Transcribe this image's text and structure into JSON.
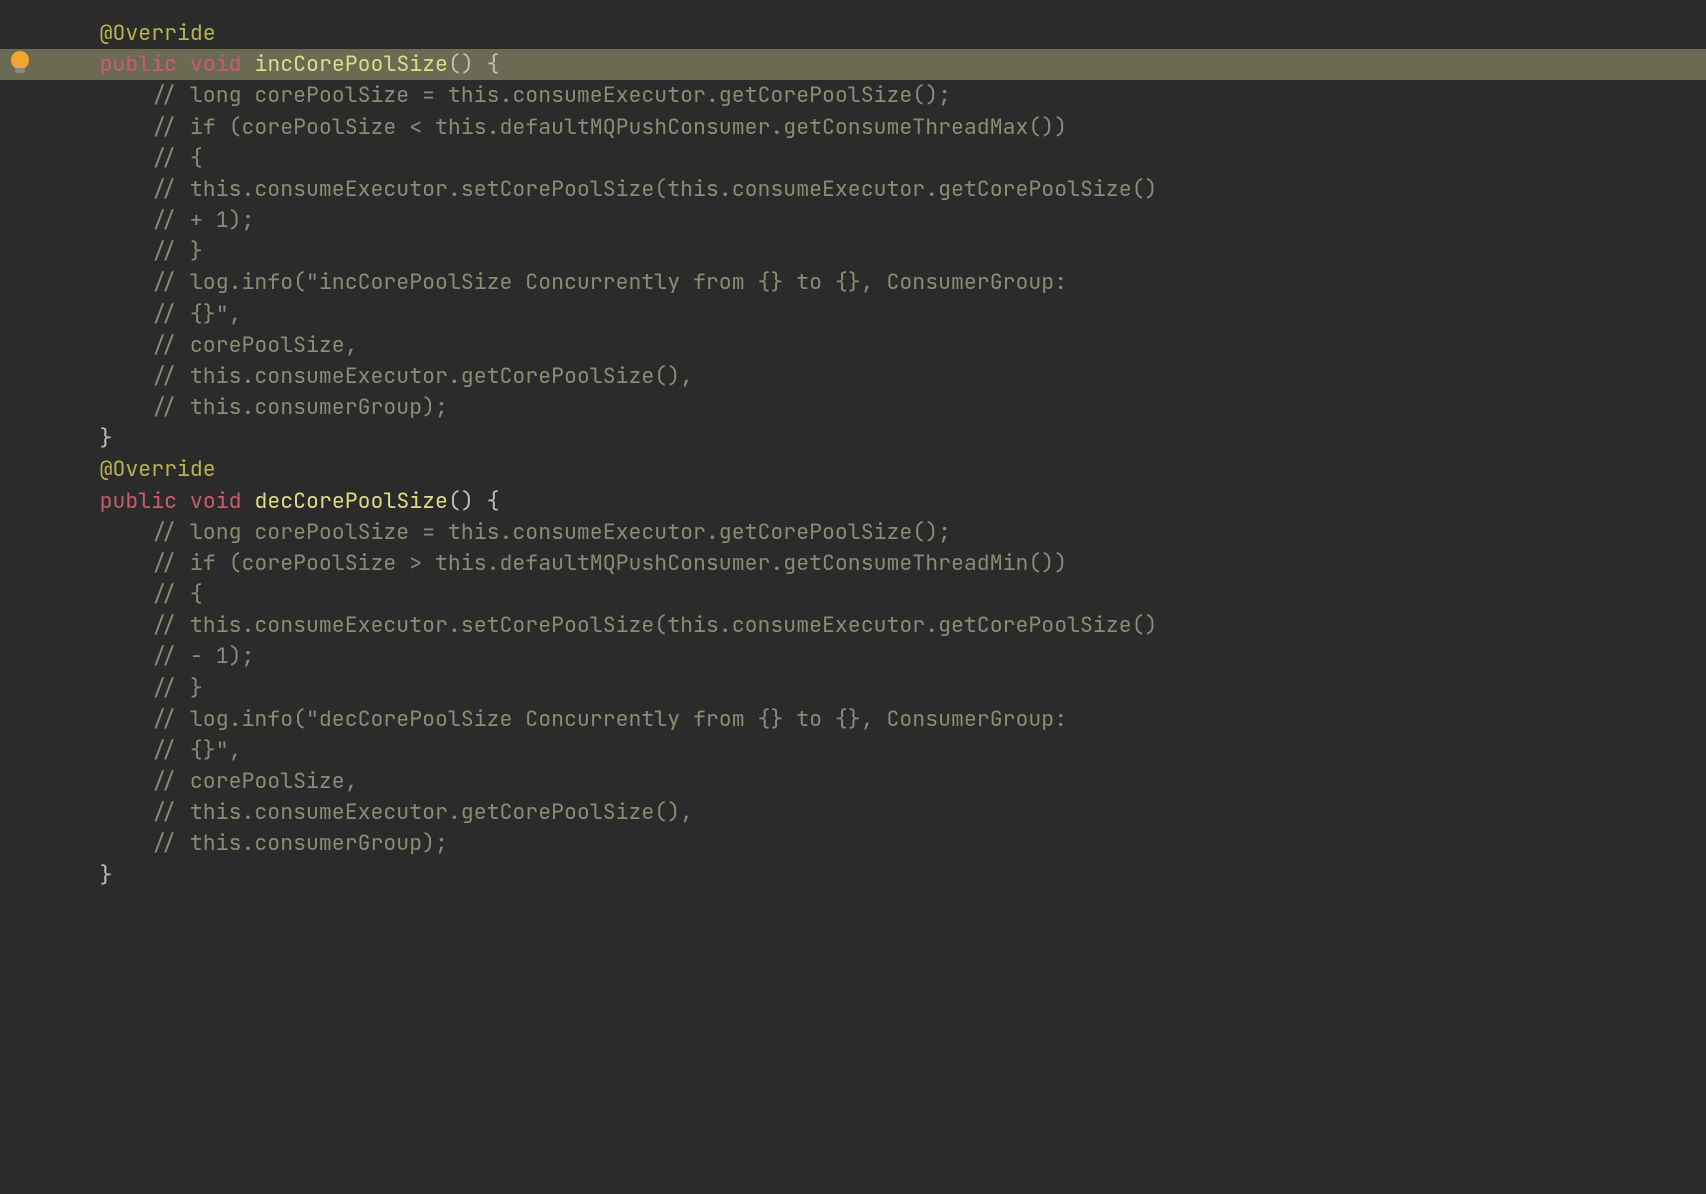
{
  "code": {
    "l1_indent": "    ",
    "l1_ann": "@Override",
    "l2_indent": "    ",
    "l2_kw1": "public",
    "l2_sp1": " ",
    "l2_kw2": "void",
    "l2_sp2": " ",
    "l2_method": "incCorePoolSize",
    "l2_parens": "()",
    "l2_sp3": " ",
    "l2_brace": "{",
    "l3": "        // long corePoolSize = this.consumeExecutor.getCorePoolSize();",
    "l4": "        // if (corePoolSize < this.defaultMQPushConsumer.getConsumeThreadMax())",
    "l5": "        // {",
    "l6": "        // this.consumeExecutor.setCorePoolSize(this.consumeExecutor.getCorePoolSize()",
    "l7": "        // + 1);",
    "l8": "        // }",
    "l9": "        // log.info(\"incCorePoolSize Concurrently from {} to {}, ConsumerGroup:",
    "l10": "        // {}\",",
    "l11": "        // corePoolSize,",
    "l12": "        // this.consumeExecutor.getCorePoolSize(),",
    "l13": "        // this.consumerGroup);",
    "l14_indent": "    ",
    "l14_brace": "}",
    "l15": "",
    "l16_indent": "    ",
    "l16_ann": "@Override",
    "l17_indent": "    ",
    "l17_kw1": "public",
    "l17_sp1": " ",
    "l17_kw2": "void",
    "l17_sp2": " ",
    "l17_method": "decCorePoolSize",
    "l17_parens": "()",
    "l17_sp3": " ",
    "l17_brace": "{",
    "l18": "        // long corePoolSize = this.consumeExecutor.getCorePoolSize();",
    "l19": "        // if (corePoolSize > this.defaultMQPushConsumer.getConsumeThreadMin())",
    "l20": "        // {",
    "l21": "        // this.consumeExecutor.setCorePoolSize(this.consumeExecutor.getCorePoolSize()",
    "l22": "        // - 1);",
    "l23": "        // }",
    "l24": "        // log.info(\"decCorePoolSize Concurrently from {} to {}, ConsumerGroup:",
    "l25": "        // {}\",",
    "l26": "        // corePoolSize,",
    "l27": "        // this.consumeExecutor.getCorePoolSize(),",
    "l28": "        // this.consumerGroup);",
    "l29_indent": "    ",
    "l29_brace": "}"
  }
}
